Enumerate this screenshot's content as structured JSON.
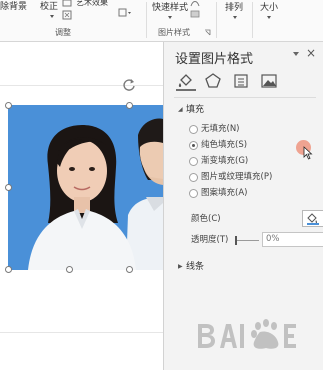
{
  "ribbon": {
    "remove_bg_label": "除背景",
    "correct_label": "校正",
    "artistic_label": "艺术效果",
    "adjust_group": "调整",
    "quick_styles_label": "快速样式",
    "picture_styles_group": "图片样式",
    "arrange_label": "排列",
    "size_label": "大小"
  },
  "pane": {
    "title": "设置图片格式",
    "close_symbol": "×",
    "fill_section": "填充",
    "fill_options": [
      {
        "label": "无填充(N)",
        "selected": false
      },
      {
        "label": "纯色填充(S)",
        "selected": true
      },
      {
        "label": "渐变填充(G)",
        "selected": false
      },
      {
        "label": "图片或纹理填充(P)",
        "selected": false
      },
      {
        "label": "图案填充(A)",
        "selected": false
      }
    ],
    "color_label": "颜色(C)",
    "transparency_label": "透明度(T)",
    "transparency_value": "0%",
    "line_section": "线条"
  },
  "colors": {
    "photo_background": "#4a90d8",
    "pane_background": "#f3f3f3",
    "cursor_highlight": "#ee9a86"
  },
  "icons": [
    "fill-bucket-icon",
    "pentagon-effects-icon",
    "size-properties-icon",
    "picture-icon",
    "rotate-icon",
    "cursor-icon",
    "paint-bucket-icon",
    "close-icon"
  ]
}
